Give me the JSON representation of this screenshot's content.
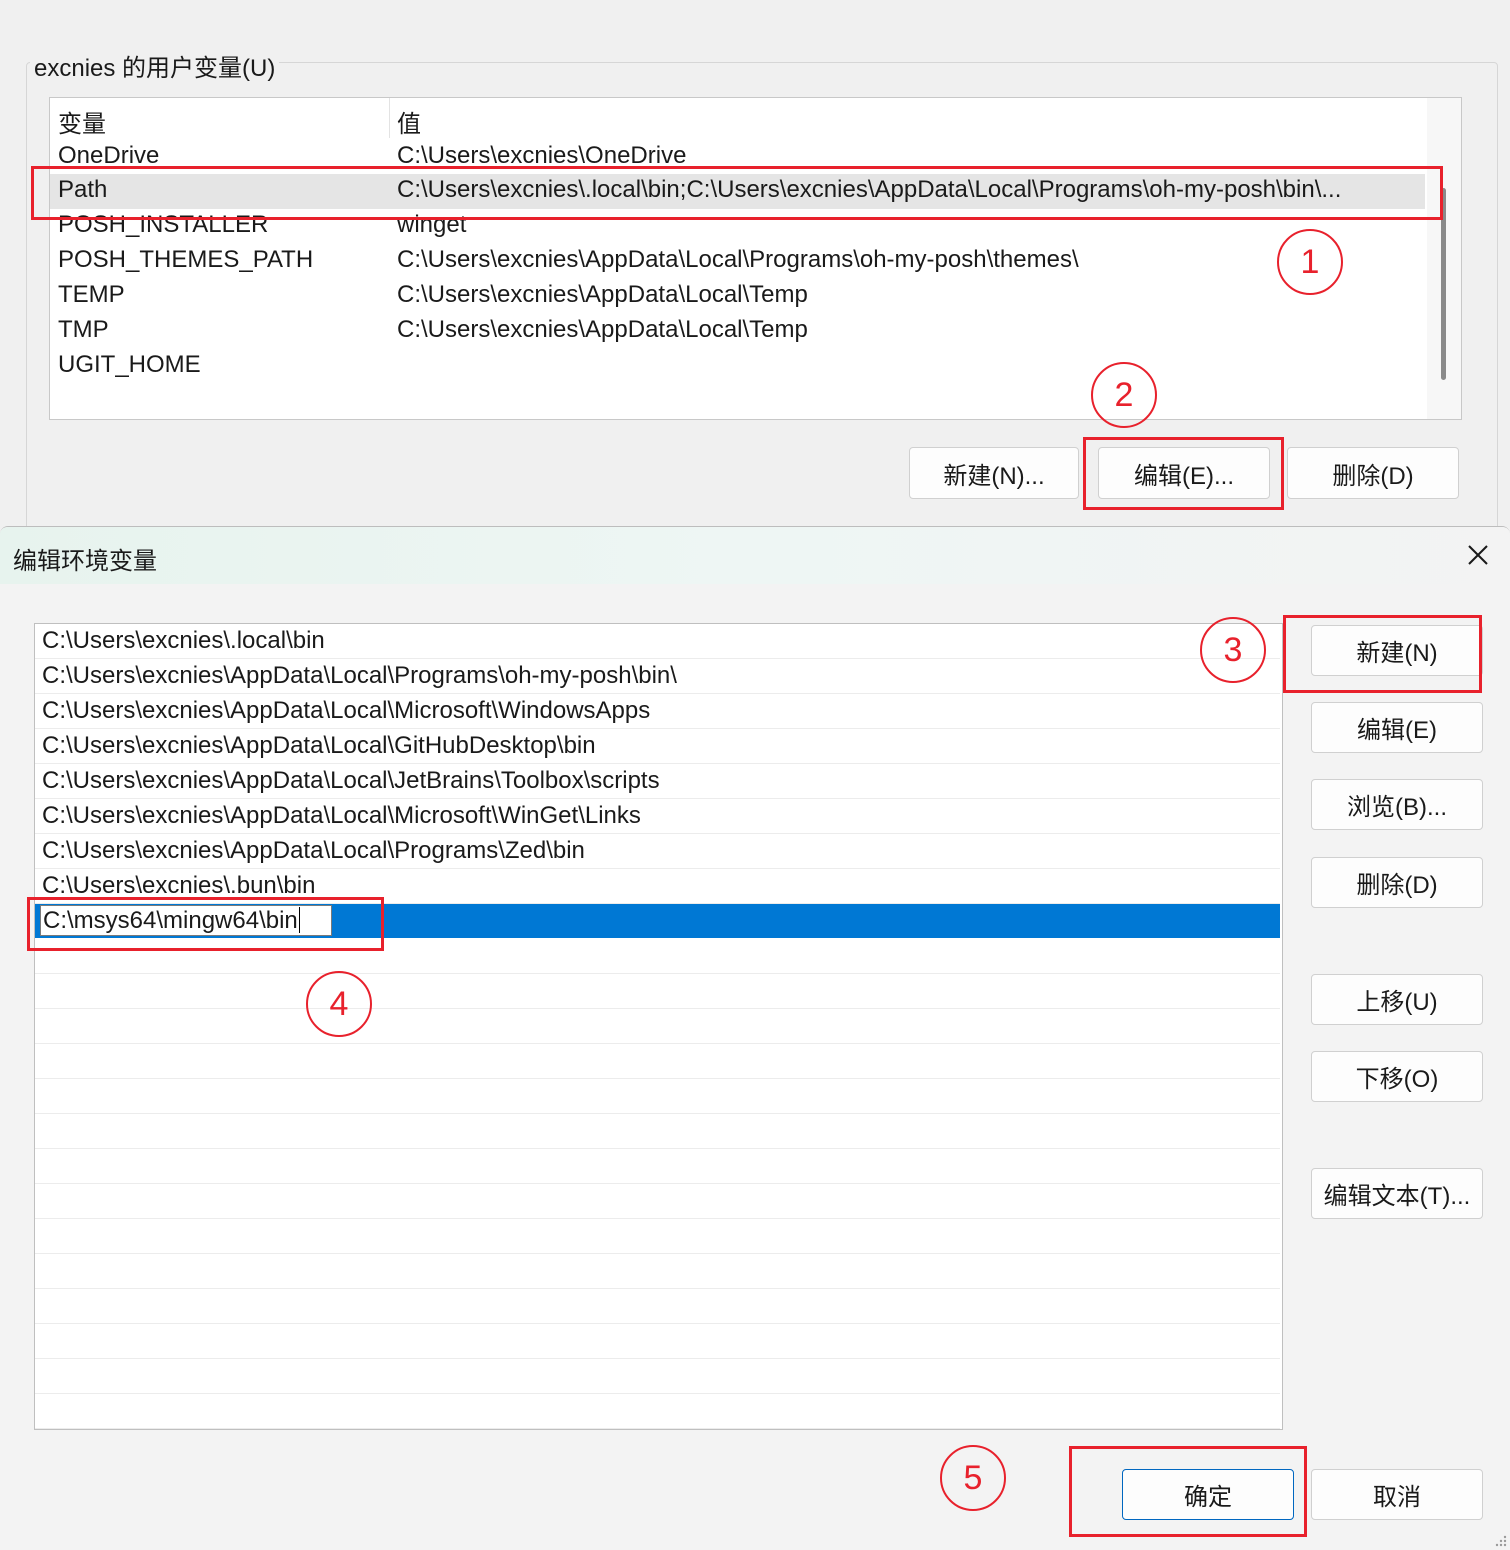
{
  "user_vars": {
    "group_title": "excnies 的用户变量(U)",
    "columns": {
      "name": "变量",
      "value": "值"
    },
    "rows": [
      {
        "name": "OneDrive",
        "value": "C:\\Users\\excnies\\OneDrive"
      },
      {
        "name": "Path",
        "value": "C:\\Users\\excnies\\.local\\bin;C:\\Users\\excnies\\AppData\\Local\\Programs\\oh-my-posh\\bin\\..."
      },
      {
        "name": "POSH_INSTALLER",
        "value": "winget"
      },
      {
        "name": "POSH_THEMES_PATH",
        "value": "C:\\Users\\excnies\\AppData\\Local\\Programs\\oh-my-posh\\themes\\"
      },
      {
        "name": "TEMP",
        "value": "C:\\Users\\excnies\\AppData\\Local\\Temp"
      },
      {
        "name": "TMP",
        "value": "C:\\Users\\excnies\\AppData\\Local\\Temp"
      },
      {
        "name": "UGIT_HOME",
        "value": ""
      }
    ],
    "selected_row": "Path",
    "buttons": {
      "new": "新建(N)...",
      "edit": "编辑(E)...",
      "delete": "删除(D)"
    }
  },
  "dialog": {
    "title": "编辑环境变量",
    "entries": [
      "C:\\Users\\excnies\\.local\\bin",
      "C:\\Users\\excnies\\AppData\\Local\\Programs\\oh-my-posh\\bin\\",
      "C:\\Users\\excnies\\AppData\\Local\\Microsoft\\WindowsApps",
      "C:\\Users\\excnies\\AppData\\Local\\GitHubDesktop\\bin",
      "C:\\Users\\excnies\\AppData\\Local\\JetBrains\\Toolbox\\scripts",
      "C:\\Users\\excnies\\AppData\\Local\\Microsoft\\WinGet\\Links",
      "C:\\Users\\excnies\\AppData\\Local\\Programs\\Zed\\bin",
      "C:\\Users\\excnies\\.bun\\bin"
    ],
    "editing_entry": "C:\\msys64\\mingw64\\bin",
    "side_buttons": {
      "new": "新建(N)",
      "edit": "编辑(E)",
      "browse": "浏览(B)...",
      "delete": "删除(D)",
      "move_up": "上移(U)",
      "move_down": "下移(O)",
      "edit_text": "编辑文本(T)..."
    },
    "ok_label": "确定",
    "cancel_label": "取消"
  },
  "annotations": {
    "step_labels": [
      "1",
      "2",
      "3",
      "4",
      "5"
    ],
    "color": "#e8212c"
  },
  "colors": {
    "selection_blue": "#0078d4",
    "accent_border": "#0067c0"
  }
}
